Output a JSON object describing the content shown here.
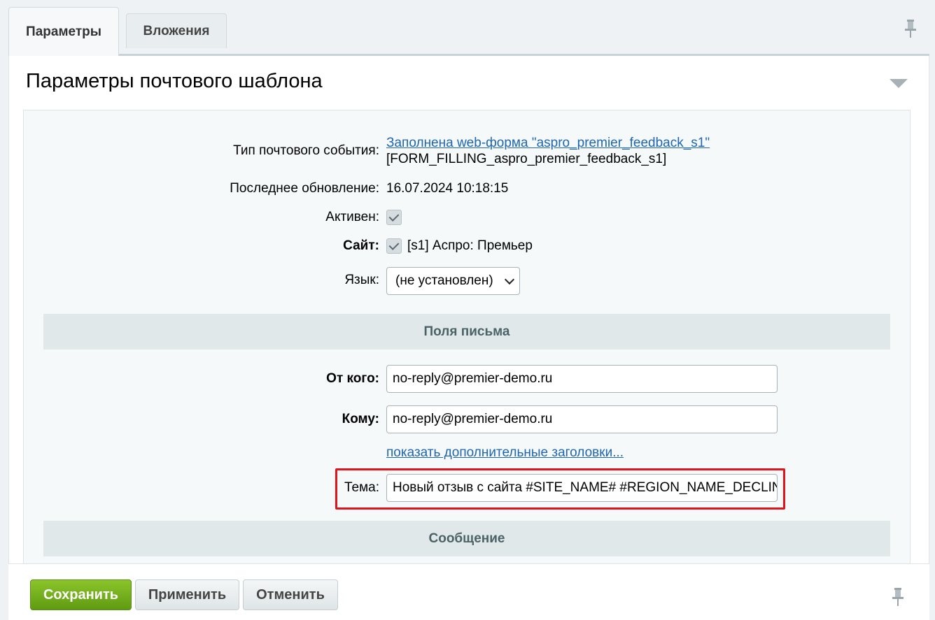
{
  "tabs": [
    {
      "label": "Параметры",
      "active": true
    },
    {
      "label": "Вложения",
      "active": false
    }
  ],
  "panel": {
    "title": "Параметры почтового шаблона"
  },
  "fields": {
    "event_type": {
      "label": "Тип почтового события:",
      "link": "Заполнена web-форма \"aspro_premier_feedback_s1\"",
      "code": "[FORM_FILLING_aspro_premier_feedback_s1]"
    },
    "last_update": {
      "label": "Последнее обновление:",
      "value": "16.07.2024 10:18:15"
    },
    "active": {
      "label": "Активен:",
      "checked": true
    },
    "site": {
      "label": "Сайт:",
      "checked": true,
      "value": "[s1] Аспро: Премьер"
    },
    "language": {
      "label": "Язык:",
      "selected": "(не установлен)"
    }
  },
  "letter_section": {
    "title": "Поля письма",
    "from": {
      "label": "От кого:",
      "value": "no-reply@premier-demo.ru"
    },
    "to": {
      "label": "Кому:",
      "value": "no-reply@premier-demo.ru"
    },
    "extra_headers_link": "показать дополнительные заголовки...",
    "subject": {
      "label": "Тема:",
      "value": "Новый отзыв с сайта #SITE_NAME# #REGION_NAME_DECLINE_RP#"
    }
  },
  "message_section": {
    "title": "Сообщение"
  },
  "footer": {
    "save": "Сохранить",
    "apply": "Применить",
    "cancel": "Отменить"
  },
  "colors": {
    "save_button": "#7ab51f",
    "highlight_border": "#e1131b",
    "link": "#2067b0"
  }
}
